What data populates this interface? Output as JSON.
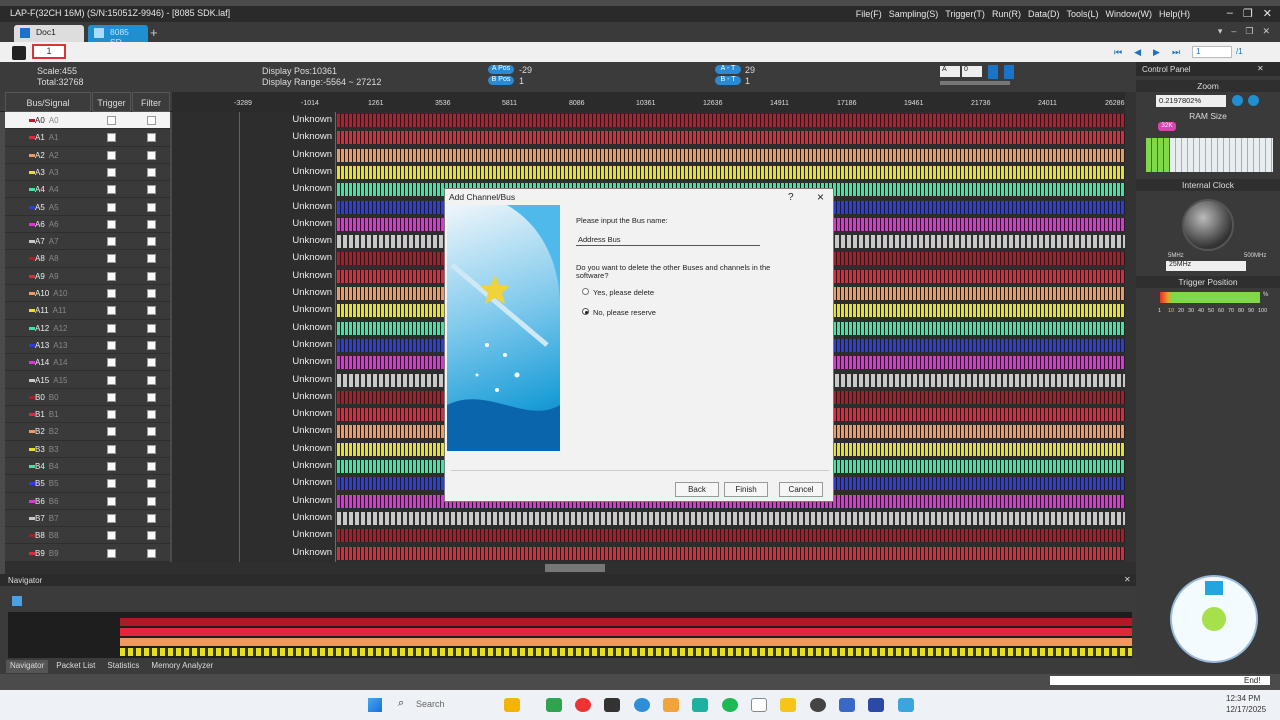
{
  "window": {
    "title": "LAP-F(32CH 16M) (S/N:15051Z-9946) - [8085 SDK.laf]",
    "menu": [
      "File(F)",
      "Sampling(S)",
      "Trigger(T)",
      "Run(R)",
      "Data(D)",
      "Tools(L)",
      "Window(W)",
      "Help(H)"
    ]
  },
  "tabs": [
    {
      "label": "Doc1"
    },
    {
      "label": "8085 SD..."
    }
  ],
  "toolbar": {
    "page_value": "1",
    "right_page": "1",
    "right_total": "/1"
  },
  "info": {
    "scale": "Scale:455",
    "total": "Total:32768",
    "display_pos": "Display Pos:10361",
    "display_range": "Display Range:-5564 ~ 27212",
    "a_pos_label": "A Pos",
    "a_pos": "-29",
    "b_pos_label": "B Pos",
    "b_pos": "1",
    "a_t_label": "A - T",
    "a_t": "29",
    "b_t_label": "B - T",
    "b_t": "1",
    "sel_a": "A",
    "sel_0": "0"
  },
  "columns": {
    "bus": "Bus/Signal",
    "trigger": "Trigger",
    "filter": "Filter"
  },
  "ruler": [
    "-3289",
    "-1014",
    "1261",
    "3536",
    "5811",
    "8086",
    "10361",
    "12636",
    "14911",
    "17186",
    "19461",
    "21736",
    "24011",
    "26286"
  ],
  "signals": [
    {
      "name": "A0",
      "alias": "A0",
      "color": "#c0182a"
    },
    {
      "name": "A1",
      "alias": "A1",
      "color": "#e0283a"
    },
    {
      "name": "A2",
      "alias": "A2",
      "color": "#ee9960"
    },
    {
      "name": "A3",
      "alias": "A3",
      "color": "#e6e020"
    },
    {
      "name": "A4",
      "alias": "A4",
      "color": "#3ce6a0"
    },
    {
      "name": "A5",
      "alias": "A5",
      "color": "#2a3de0"
    },
    {
      "name": "A6",
      "alias": "A6",
      "color": "#e032d8"
    },
    {
      "name": "A7",
      "alias": "A7",
      "color": "#c8c8c8"
    },
    {
      "name": "A8",
      "alias": "A8",
      "color": "#b01a26"
    },
    {
      "name": "A9",
      "alias": "A9",
      "color": "#e0283a"
    },
    {
      "name": "A10",
      "alias": "A10",
      "color": "#ee9960"
    },
    {
      "name": "A11",
      "alias": "A11",
      "color": "#e6e020"
    },
    {
      "name": "A12",
      "alias": "A12",
      "color": "#3ce6a0"
    },
    {
      "name": "A13",
      "alias": "A13",
      "color": "#2a3de0"
    },
    {
      "name": "A14",
      "alias": "A14",
      "color": "#e032d8"
    },
    {
      "name": "A15",
      "alias": "A15",
      "color": "#c8c8c8"
    },
    {
      "name": "B0",
      "alias": "B0",
      "color": "#b01a26"
    },
    {
      "name": "B1",
      "alias": "B1",
      "color": "#e0283a"
    },
    {
      "name": "B2",
      "alias": "B2",
      "color": "#ee9960"
    },
    {
      "name": "B3",
      "alias": "B3",
      "color": "#e6e020"
    },
    {
      "name": "B4",
      "alias": "B4",
      "color": "#3ce6a0"
    },
    {
      "name": "B5",
      "alias": "B5",
      "color": "#2a3de0"
    },
    {
      "name": "B6",
      "alias": "B6",
      "color": "#e032d8"
    },
    {
      "name": "B7",
      "alias": "B7",
      "color": "#c8c8c8"
    },
    {
      "name": "B8",
      "alias": "B8",
      "color": "#b01a26"
    },
    {
      "name": "B9",
      "alias": "B9",
      "color": "#e0283a"
    }
  ],
  "unknown_label": "Unknown",
  "dialog": {
    "title": "Add Channel/Bus",
    "help": "?",
    "close": "×",
    "prompt": "Please input the Bus name:",
    "bus_name": "Address Bus",
    "question": "Do you want to delete the other Buses and channels in the software?",
    "opt_yes": "Yes, please delete",
    "opt_no": "No, please reserve",
    "back": "Back",
    "finish": "Finish",
    "cancel": "Cancel"
  },
  "control_panel": {
    "title": "Control Panel",
    "zoom": "Zoom",
    "zoom_value": "0.2197802%",
    "ram": "RAM Size",
    "ram_badge": "32K",
    "clock": "Internal Clock",
    "clock_min": "5MHz",
    "clock_max": "500MHz",
    "clock_value": "25MHz",
    "trigger_position": "Trigger Position",
    "trigger_percent": "%",
    "trigger_ticks": [
      "1",
      "10",
      "20",
      "30",
      "40",
      "50",
      "60",
      "70",
      "80",
      "90",
      "100"
    ]
  },
  "navigator": {
    "title": "Navigator",
    "tabs": [
      "Navigator",
      "Packet List",
      "Statistics",
      "Memory Analyzer"
    ]
  },
  "status": {
    "end": "End!"
  },
  "taskbar": {
    "search": "Search",
    "time": "12:34 PM",
    "date": "12/17/2025"
  }
}
